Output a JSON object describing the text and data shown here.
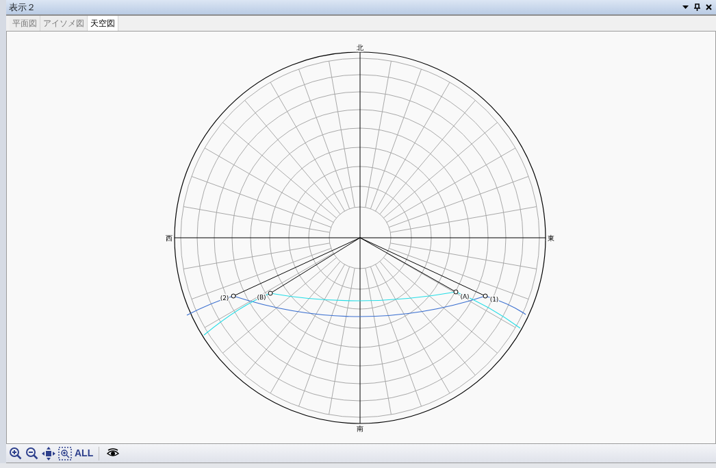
{
  "window": {
    "title": "表示２",
    "controls": [
      {
        "kind": "dropdown"
      },
      {
        "kind": "pin"
      },
      {
        "kind": "close"
      }
    ]
  },
  "tabs": [
    {
      "label": "平面図",
      "selected": false
    },
    {
      "label": "アイソメ図",
      "selected": false
    },
    {
      "label": "天空図",
      "selected": true
    }
  ],
  "diagram": {
    "directions": [
      {
        "kind": "north",
        "label": "北"
      },
      {
        "kind": "east",
        "label": "東"
      },
      {
        "kind": "south",
        "label": "南"
      },
      {
        "kind": "west",
        "label": "西"
      }
    ],
    "points": [
      {
        "label": "(2)"
      },
      {
        "label": "(B)"
      },
      {
        "label": "(A)"
      },
      {
        "label": "(1)"
      }
    ]
  },
  "toolbar": [
    {
      "kind": "zoom-in"
    },
    {
      "kind": "zoom-out"
    },
    {
      "kind": "pan"
    },
    {
      "kind": "zoom-window"
    },
    {
      "kind": "all",
      "label": "ALL"
    },
    {
      "kind": "separator"
    },
    {
      "kind": "eye"
    }
  ]
}
